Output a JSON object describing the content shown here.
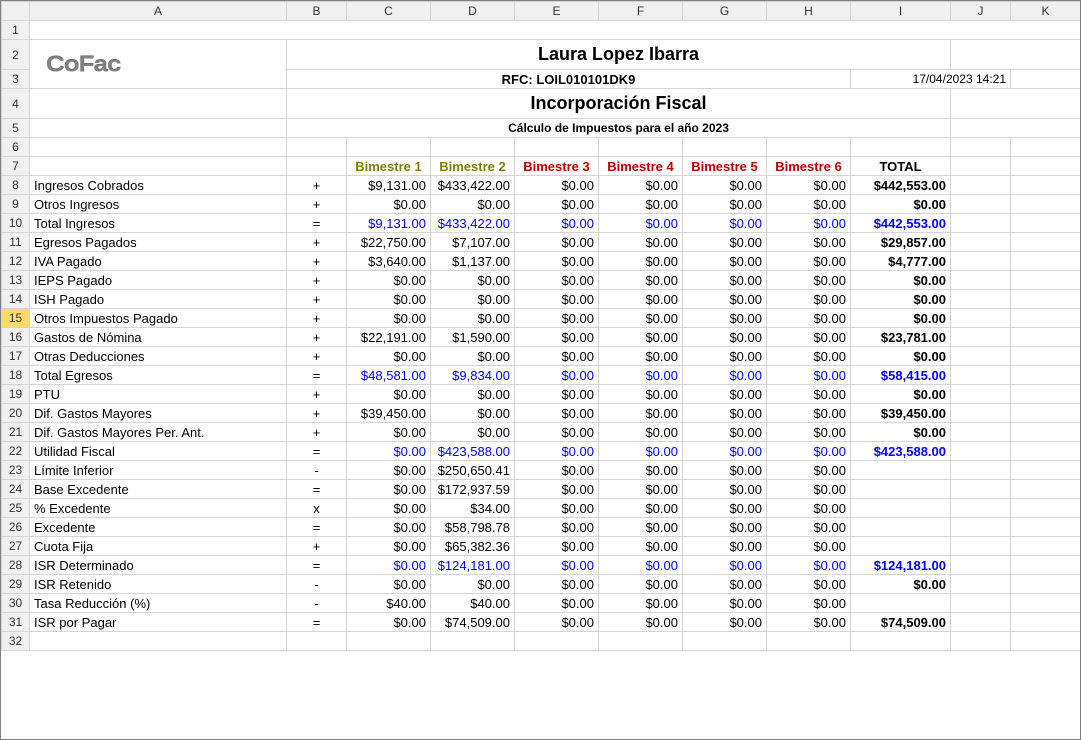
{
  "columns": [
    "A",
    "B",
    "C",
    "D",
    "E",
    "F",
    "G",
    "H",
    "I",
    "J",
    "K"
  ],
  "logo_text": "CoFac",
  "header": {
    "person": "Laura Lopez Ibarra",
    "rfc": "RFC: LOIL010101DK9",
    "section": "Incorporación Fiscal",
    "subtitle": "Cálculo de Impuestos para el año 2023",
    "date": "17/04/2023 14:21"
  },
  "col_headers": {
    "b1": "Bimestre 1",
    "b2": "Bimestre 2",
    "b3": "Bimestre 3",
    "b4": "Bimestre 4",
    "b5": "Bimestre 5",
    "b6": "Bimestre 6",
    "total": "TOTAL"
  },
  "rows": [
    {
      "n": 8,
      "label": "Ingresos Cobrados",
      "op": "+",
      "v": [
        "$9,131.00",
        "$433,422.00",
        "$0.00",
        "$0.00",
        "$0.00",
        "$0.00"
      ],
      "total": "$442,553.00",
      "style": "plain",
      "tbold": true
    },
    {
      "n": 9,
      "label": "Otros Ingresos",
      "op": "+",
      "v": [
        "$0.00",
        "$0.00",
        "$0.00",
        "$0.00",
        "$0.00",
        "$0.00"
      ],
      "total": "$0.00",
      "style": "plain",
      "tbold": true
    },
    {
      "n": 10,
      "label": "Total Ingresos",
      "op": "=",
      "v": [
        "$9,131.00",
        "$433,422.00",
        "$0.00",
        "$0.00",
        "$0.00",
        "$0.00"
      ],
      "total": "$442,553.00",
      "style": "blue",
      "tbold": true,
      "tblue": true
    },
    {
      "n": 11,
      "label": "Egresos Pagados",
      "op": "+",
      "v": [
        "$22,750.00",
        "$7,107.00",
        "$0.00",
        "$0.00",
        "$0.00",
        "$0.00"
      ],
      "total": "$29,857.00",
      "style": "plain",
      "tbold": true
    },
    {
      "n": 12,
      "label": "IVA Pagado",
      "op": "+",
      "v": [
        "$3,640.00",
        "$1,137.00",
        "$0.00",
        "$0.00",
        "$0.00",
        "$0.00"
      ],
      "total": "$4,777.00",
      "style": "plain",
      "tbold": true
    },
    {
      "n": 13,
      "label": "IEPS Pagado",
      "op": "+",
      "v": [
        "$0.00",
        "$0.00",
        "$0.00",
        "$0.00",
        "$0.00",
        "$0.00"
      ],
      "total": "$0.00",
      "style": "plain",
      "tbold": true
    },
    {
      "n": 14,
      "label": "ISH Pagado",
      "op": "+",
      "v": [
        "$0.00",
        "$0.00",
        "$0.00",
        "$0.00",
        "$0.00",
        "$0.00"
      ],
      "total": "$0.00",
      "style": "plain",
      "tbold": true
    },
    {
      "n": 15,
      "label": "Otros Impuestos Pagado",
      "op": "+",
      "v": [
        "$0.00",
        "$0.00",
        "$0.00",
        "$0.00",
        "$0.00",
        "$0.00"
      ],
      "total": "$0.00",
      "style": "plain",
      "tbold": true,
      "sel": true
    },
    {
      "n": 16,
      "label": "Gastos de Nómina",
      "op": "+",
      "v": [
        "$22,191.00",
        "$1,590.00",
        "$0.00",
        "$0.00",
        "$0.00",
        "$0.00"
      ],
      "total": "$23,781.00",
      "style": "plain",
      "tbold": true
    },
    {
      "n": 17,
      "label": "Otras Deducciones",
      "op": "+",
      "v": [
        "$0.00",
        "$0.00",
        "$0.00",
        "$0.00",
        "$0.00",
        "$0.00"
      ],
      "total": "$0.00",
      "style": "plain",
      "tbold": true
    },
    {
      "n": 18,
      "label": "Total Egresos",
      "op": "=",
      "v": [
        "$48,581.00",
        "$9,834.00",
        "$0.00",
        "$0.00",
        "$0.00",
        "$0.00"
      ],
      "total": "$58,415.00",
      "style": "blue",
      "tbold": true,
      "tblue": true
    },
    {
      "n": 19,
      "label": "PTU",
      "op": "+",
      "v": [
        "$0.00",
        "$0.00",
        "$0.00",
        "$0.00",
        "$0.00",
        "$0.00"
      ],
      "total": "$0.00",
      "style": "plain",
      "tbold": true
    },
    {
      "n": 20,
      "label": "Dif. Gastos Mayores",
      "op": "+",
      "v": [
        "$39,450.00",
        "$0.00",
        "$0.00",
        "$0.00",
        "$0.00",
        "$0.00"
      ],
      "total": "$39,450.00",
      "style": "plain",
      "tbold": true
    },
    {
      "n": 21,
      "label": "Dif. Gastos Mayores Per. Ant.",
      "op": "+",
      "v": [
        "$0.00",
        "$0.00",
        "$0.00",
        "$0.00",
        "$0.00",
        "$0.00"
      ],
      "total": "$0.00",
      "style": "plain",
      "tbold": true
    },
    {
      "n": 22,
      "label": "Utilidad Fiscal",
      "op": "=",
      "v": [
        "$0.00",
        "$423,588.00",
        "$0.00",
        "$0.00",
        "$0.00",
        "$0.00"
      ],
      "total": "$423,588.00",
      "style": "blue",
      "tbold": true,
      "tblue": true
    },
    {
      "n": 23,
      "label": "Límite Inferior",
      "op": "-",
      "v": [
        "$0.00",
        "$250,650.41",
        "$0.00",
        "$0.00",
        "$0.00",
        "$0.00"
      ],
      "total": "",
      "style": "plain"
    },
    {
      "n": 24,
      "label": "Base Excedente",
      "op": "=",
      "v": [
        "$0.00",
        "$172,937.59",
        "$0.00",
        "$0.00",
        "$0.00",
        "$0.00"
      ],
      "total": "",
      "style": "plain"
    },
    {
      "n": 25,
      "label": "% Excedente",
      "op": "x",
      "v": [
        "$0.00",
        "$34.00",
        "$0.00",
        "$0.00",
        "$0.00",
        "$0.00"
      ],
      "total": "",
      "style": "plain"
    },
    {
      "n": 26,
      "label": "Excedente",
      "op": "=",
      "v": [
        "$0.00",
        "$58,798.78",
        "$0.00",
        "$0.00",
        "$0.00",
        "$0.00"
      ],
      "total": "",
      "style": "plain"
    },
    {
      "n": 27,
      "label": "Cuota Fija",
      "op": "+",
      "v": [
        "$0.00",
        "$65,382.36",
        "$0.00",
        "$0.00",
        "$0.00",
        "$0.00"
      ],
      "total": "",
      "style": "plain"
    },
    {
      "n": 28,
      "label": "ISR Determinado",
      "op": "=",
      "v": [
        "$0.00",
        "$124,181.00",
        "$0.00",
        "$0.00",
        "$0.00",
        "$0.00"
      ],
      "total": "$124,181.00",
      "style": "blue",
      "tbold": true,
      "tblue": true
    },
    {
      "n": 29,
      "label": "ISR Retenido",
      "op": "-",
      "v": [
        "$0.00",
        "$0.00",
        "$0.00",
        "$0.00",
        "$0.00",
        "$0.00"
      ],
      "total": "$0.00",
      "style": "plain",
      "tbold": true
    },
    {
      "n": 30,
      "label": "Tasa Reducción (%)",
      "op": "-",
      "v": [
        "$40.00",
        "$40.00",
        "$0.00",
        "$0.00",
        "$0.00",
        "$0.00"
      ],
      "total": "",
      "style": "plain"
    },
    {
      "n": 31,
      "label": "ISR por Pagar",
      "op": "=",
      "v": [
        "$0.00",
        "$74,509.00",
        "$0.00",
        "$0.00",
        "$0.00",
        "$0.00"
      ],
      "total": "$74,509.00",
      "style": "plain",
      "tbold": true
    }
  ]
}
